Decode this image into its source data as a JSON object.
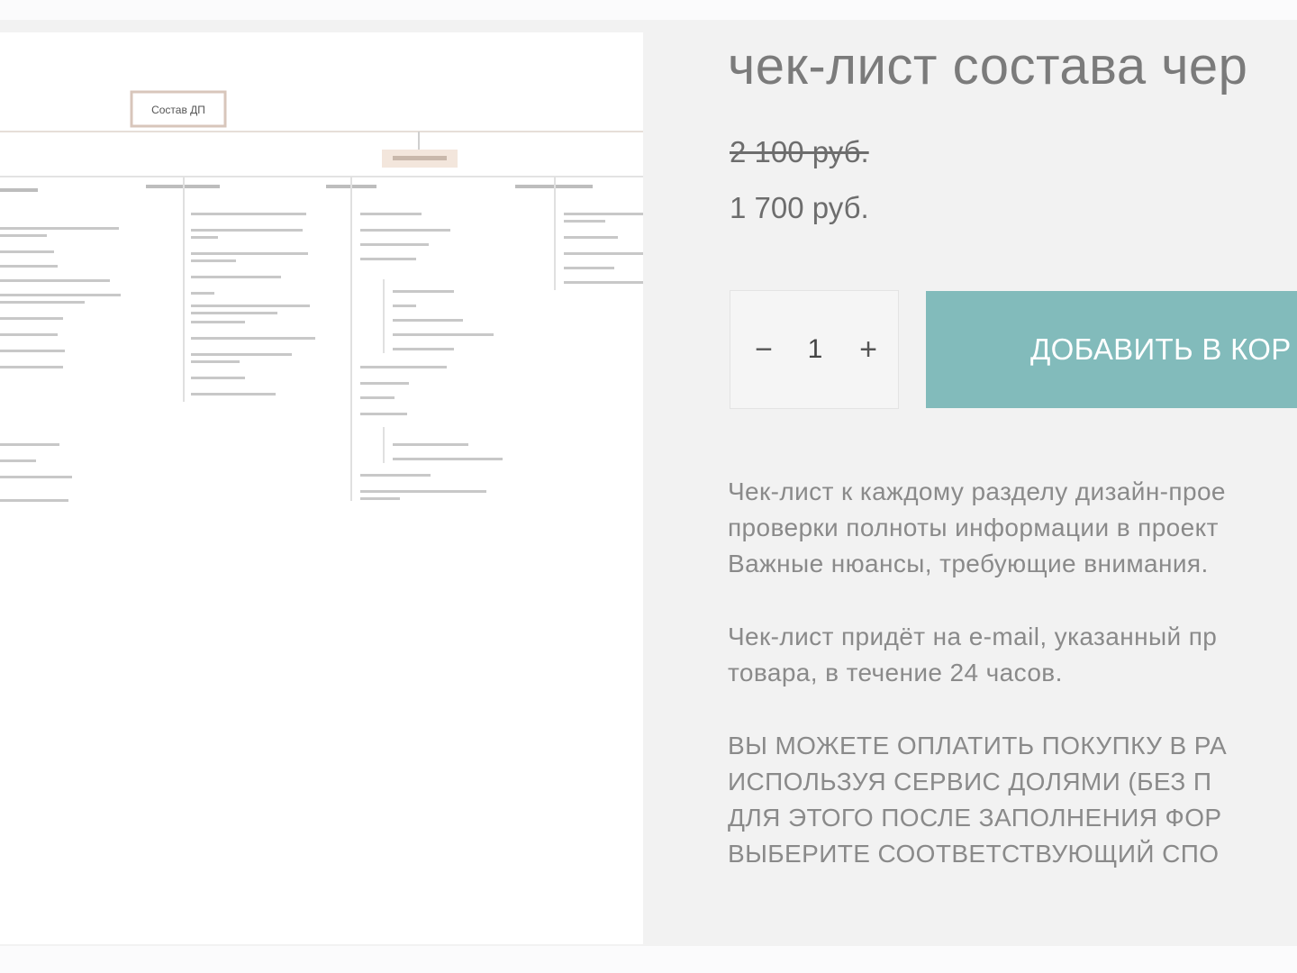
{
  "product": {
    "title": "чек-лист состава чер",
    "old_price": "2 100 руб.",
    "new_price": "1 700 руб.",
    "quantity": {
      "minus": "−",
      "value": "1",
      "plus": "+"
    },
    "add_to_cart_label": "ДОБАВИТЬ В КОР",
    "description": {
      "paragraph_1": [
        "Чек-лист к каждому разделу дизайн-прое",
        "проверки полноты информации в проект",
        "Важные нюансы, требующие внимания."
      ],
      "paragraph_2": [
        "Чек-лист придёт на e-mail, указанный пр",
        "товара, в течение 24 часов."
      ],
      "paragraph_3": [
        "ВЫ МОЖЕТЕ ОПЛАТИТЬ ПОКУПКУ В РА",
        "ИСПОЛЬЗУЯ СЕРВИС ДОЛЯМИ (БЕЗ П",
        "ДЛЯ ЭТОГО ПОСЛЕ ЗАПОЛНЕНИЯ ФОР",
        "ВЫБЕРИТЕ СООТВЕТСТВУЮЩИЙ СПО"
      ]
    }
  },
  "product_image": {
    "diagram_root_label": "Состав ДП"
  },
  "colors": {
    "page_background": "#f2f2f2",
    "button_teal": "#82bbbb",
    "text_gray": "#8a8a8a",
    "price_gray": "#6d6d6d"
  }
}
